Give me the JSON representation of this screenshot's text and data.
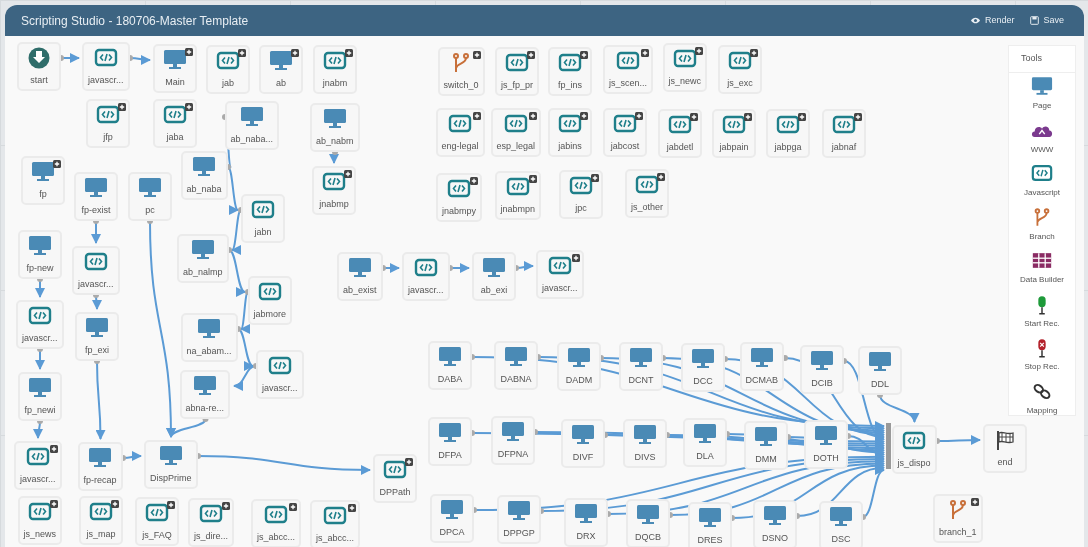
{
  "window": {
    "title": "Scripting Studio - 180706-Master Template",
    "actions": [
      {
        "label": "Render",
        "kind": "render"
      },
      {
        "label": "Save",
        "kind": "save"
      }
    ]
  },
  "nodes": [
    {
      "label": "start",
      "kind": "start",
      "plus": false
    },
    {
      "label": "javascr...",
      "kind": "script",
      "plus": false
    },
    {
      "label": "Main",
      "kind": "page",
      "plus": true
    },
    {
      "label": "jab",
      "kind": "script",
      "plus": true
    },
    {
      "label": "ab",
      "kind": "page",
      "plus": true
    },
    {
      "label": "jnabm",
      "kind": "script",
      "plus": true
    },
    {
      "label": "jfp",
      "kind": "script",
      "plus": true
    },
    {
      "label": "jaba",
      "kind": "script",
      "plus": true
    },
    {
      "label": "ab_naba...",
      "kind": "page",
      "plus": false
    },
    {
      "label": "ab_nabm",
      "kind": "page",
      "plus": false
    },
    {
      "label": "fp",
      "kind": "page",
      "plus": true
    },
    {
      "label": "fp-exist",
      "kind": "page",
      "plus": false
    },
    {
      "label": "pc",
      "kind": "page",
      "plus": false
    },
    {
      "label": "ab_naba",
      "kind": "page",
      "plus": false
    },
    {
      "label": "jabn",
      "kind": "script",
      "plus": false
    },
    {
      "label": "jnabmp",
      "kind": "script",
      "plus": true
    },
    {
      "label": "fp-new",
      "kind": "page",
      "plus": false
    },
    {
      "label": "javascr...",
      "kind": "script",
      "plus": false
    },
    {
      "label": "ab_nalmp",
      "kind": "page",
      "plus": false
    },
    {
      "label": "jabmore",
      "kind": "script",
      "plus": false
    },
    {
      "label": "javascr...",
      "kind": "script",
      "plus": false
    },
    {
      "label": "fp_exi",
      "kind": "page",
      "plus": false
    },
    {
      "label": "na_abam...",
      "kind": "page",
      "plus": false
    },
    {
      "label": "javascr...",
      "kind": "script",
      "plus": false
    },
    {
      "label": "fp_newi",
      "kind": "page",
      "plus": false
    },
    {
      "label": "abna-re...",
      "kind": "page",
      "plus": false
    },
    {
      "label": "javascr...",
      "kind": "script",
      "plus": true
    },
    {
      "label": "fp-recap",
      "kind": "page",
      "plus": false
    },
    {
      "label": "DispPrime",
      "kind": "page",
      "plus": false
    },
    {
      "label": "DPPath",
      "kind": "script",
      "plus": true
    },
    {
      "label": "js_news",
      "kind": "script",
      "plus": true
    },
    {
      "label": "js_map",
      "kind": "script",
      "plus": true
    },
    {
      "label": "js_FAQ",
      "kind": "script",
      "plus": true
    },
    {
      "label": "js_dire...",
      "kind": "script",
      "plus": true
    },
    {
      "label": "js_abcc...",
      "kind": "script",
      "plus": true
    },
    {
      "label": "js_abcc...",
      "kind": "script",
      "plus": true
    },
    {
      "label": "ab_exist",
      "kind": "page",
      "plus": false
    },
    {
      "label": "javascr...",
      "kind": "script",
      "plus": false
    },
    {
      "label": "ab_exi",
      "kind": "page",
      "plus": false
    },
    {
      "label": "javascr...",
      "kind": "script",
      "plus": true
    },
    {
      "label": "switch_0",
      "kind": "branch",
      "plus": true
    },
    {
      "label": "js_fp_pr",
      "kind": "script",
      "plus": true
    },
    {
      "label": "fp_ins",
      "kind": "script",
      "plus": true
    },
    {
      "label": "js_scen...",
      "kind": "script",
      "plus": true
    },
    {
      "label": "js_newc",
      "kind": "script",
      "plus": true
    },
    {
      "label": "js_exc",
      "kind": "script",
      "plus": true
    },
    {
      "label": "eng-legal",
      "kind": "script",
      "plus": true
    },
    {
      "label": "esp_legal",
      "kind": "script",
      "plus": true
    },
    {
      "label": "jabins",
      "kind": "script",
      "plus": true
    },
    {
      "label": "jabcost",
      "kind": "script",
      "plus": true
    },
    {
      "label": "jabdetl",
      "kind": "script",
      "plus": true
    },
    {
      "label": "jabpain",
      "kind": "script",
      "plus": true
    },
    {
      "label": "jabpga",
      "kind": "script",
      "plus": true
    },
    {
      "label": "jabnaf",
      "kind": "script",
      "plus": true
    },
    {
      "label": "jnabmpy",
      "kind": "script",
      "plus": true
    },
    {
      "label": "jnabmpn",
      "kind": "script",
      "plus": true
    },
    {
      "label": "jpc",
      "kind": "script",
      "plus": true
    },
    {
      "label": "js_other",
      "kind": "script",
      "plus": true
    },
    {
      "label": "DABA",
      "kind": "page",
      "plus": false
    },
    {
      "label": "DABNA",
      "kind": "page",
      "plus": false
    },
    {
      "label": "DADM",
      "kind": "page",
      "plus": false
    },
    {
      "label": "DCNT",
      "kind": "page",
      "plus": false
    },
    {
      "label": "DCC",
      "kind": "page",
      "plus": false
    },
    {
      "label": "DCMAB",
      "kind": "page",
      "plus": false
    },
    {
      "label": "DCIB",
      "kind": "page",
      "plus": false
    },
    {
      "label": "DDL",
      "kind": "page",
      "plus": false
    },
    {
      "label": "DFPA",
      "kind": "page",
      "plus": false
    },
    {
      "label": "DFPNA",
      "kind": "page",
      "plus": false
    },
    {
      "label": "DIVF",
      "kind": "page",
      "plus": false
    },
    {
      "label": "DIVS",
      "kind": "page",
      "plus": false
    },
    {
      "label": "DLA",
      "kind": "page",
      "plus": false
    },
    {
      "label": "DMM",
      "kind": "page",
      "plus": false
    },
    {
      "label": "DOTH",
      "kind": "page",
      "plus": false
    },
    {
      "label": "DPCA",
      "kind": "page",
      "plus": false
    },
    {
      "label": "DPPGP",
      "kind": "page",
      "plus": false
    },
    {
      "label": "DRX",
      "kind": "page",
      "plus": false
    },
    {
      "label": "DQCB",
      "kind": "page",
      "plus": false
    },
    {
      "label": "DRES",
      "kind": "page",
      "plus": false
    },
    {
      "label": "DSNO",
      "kind": "page",
      "plus": false
    },
    {
      "label": "DSC",
      "kind": "page",
      "plus": false
    },
    {
      "label": "js_dispo",
      "kind": "script",
      "plus": false
    },
    {
      "label": "end",
      "kind": "end",
      "plus": false
    },
    {
      "label": "branch_1",
      "kind": "branch",
      "plus": true
    }
  ],
  "tools": {
    "title": "Tools",
    "items": [
      {
        "label": "Page",
        "kind": "page"
      },
      {
        "label": "WWW",
        "kind": "www"
      },
      {
        "label": "Javascript",
        "kind": "script"
      },
      {
        "label": "Branch",
        "kind": "branch"
      },
      {
        "label": "Data Builder",
        "kind": "grid"
      },
      {
        "label": "Start Rec.",
        "kind": "rec-start"
      },
      {
        "label": "Stop Rec.",
        "kind": "rec-stop"
      },
      {
        "label": "Mapping",
        "kind": "mapping"
      }
    ]
  }
}
